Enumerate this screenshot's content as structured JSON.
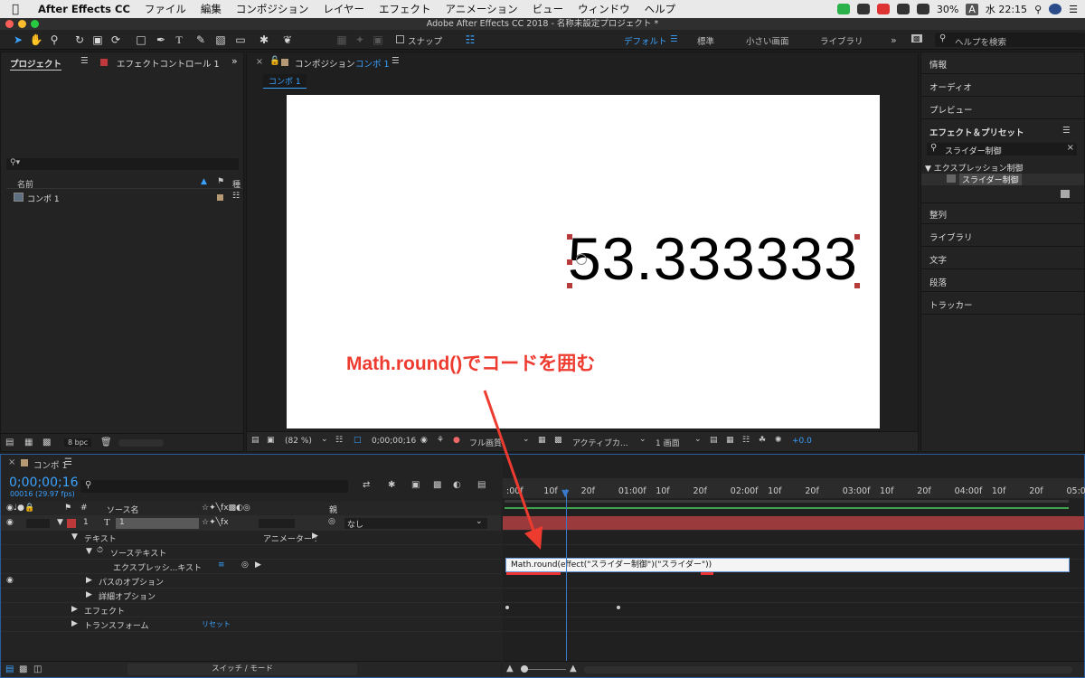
{
  "menubar": {
    "items": [
      "After Effects CC",
      "ファイル",
      "編集",
      "コンポジション",
      "レイヤー",
      "エフェクト",
      "アニメーション",
      "ビュー",
      "ウィンドウ",
      "ヘルプ"
    ],
    "battery": "30%",
    "input_method": "A",
    "clock": "水 22:15"
  },
  "title": "Adobe After Effects CC 2018 - 名称未設定プロジェクト *",
  "toolbar": {
    "snap_label": "スナップ",
    "workspaces": [
      "デフォルト",
      "標準",
      "小さい画面",
      "ライブラリ"
    ],
    "active_workspace": "デフォルト",
    "help_search_placeholder": "ヘルプを検索"
  },
  "project": {
    "tab_project": "プロジェクト",
    "tab_effect_controls": "エフェクトコントロール 1",
    "col_name": "名前",
    "col_type": "種",
    "item": "コンポ 1",
    "bpc": "8 bpc"
  },
  "composition": {
    "tab": "コンポジション",
    "tab_comp": "コンポ 1",
    "sub_tab": "コンポ 1",
    "display_text": "53.333333",
    "annotation": "Math.round()でコードを囲む",
    "zoom": "(82 %)",
    "timecode": "0;00;00;16",
    "resolution": "フル画質",
    "camera": "アクティブカ...",
    "views": "1 画面",
    "exposure": "+0.0"
  },
  "right_panel": {
    "info": "情報",
    "audio": "オーディオ",
    "preview": "プレビュー",
    "effects_presets": "エフェクト＆プリセット",
    "search_value": "スライダー制御",
    "category": "▼ エクスプレッション制御",
    "result": "スライダー制御",
    "align": "整列",
    "library": "ライブラリ",
    "character": "文字",
    "paragraph": "段落",
    "tracker": "トラッカー"
  },
  "timeline": {
    "tab": "コンポ 1",
    "timecode": "0;00;00;16",
    "frames": "00016 (29.97 fps)",
    "col_source": "ソース名",
    "col_parent": "親",
    "layer_num": "1",
    "layer_name": "1",
    "parent_value": "なし",
    "text_group": "テキスト",
    "animator": "アニメーター :",
    "source_text": "ソーステキスト",
    "expression_label": "エクスプレッシ...キスト",
    "path_options": "パスのオプション",
    "more_options": "詳細オプション",
    "effects": "エフェクト",
    "transform": "トランスフォーム",
    "reset": "リセット",
    "switches_modes": "スイッチ / モード",
    "expression_code": "Math.round(effect(\"スライダー制御\")(\"スライダー\"))",
    "ruler_ticks": [
      ":00f",
      "10f",
      "20f",
      "01:00f",
      "10f",
      "20f",
      "02:00f",
      "10f",
      "20f",
      "03:00f",
      "10f",
      "20f",
      "04:00f",
      "10f",
      "20f",
      "05:0"
    ]
  },
  "colors": {
    "accent_blue": "#3aa2ff",
    "annotation_red": "#ee3b30",
    "layer_bar": "#9b3a3d"
  }
}
